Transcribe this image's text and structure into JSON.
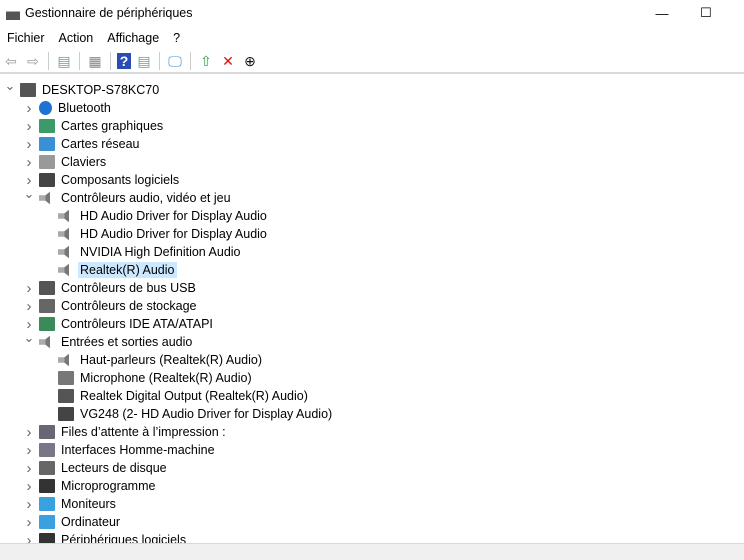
{
  "window": {
    "title": "Gestionnaire de périphériques",
    "minimize": "—",
    "maximize": "☐"
  },
  "menu": [
    "Fichier",
    "Action",
    "Affichage",
    "?"
  ],
  "toolbar": [
    {
      "name": "back-icon",
      "glyph": "⇦",
      "color": "#999"
    },
    {
      "name": "forward-icon",
      "glyph": "⇨",
      "color": "#999"
    },
    {
      "sep": true
    },
    {
      "name": "show-hide-console-tree-icon",
      "glyph": "▤",
      "color": "#6a8"
    },
    {
      "sep": true
    },
    {
      "name": "properties-icon",
      "glyph": "▦",
      "color": "#888"
    },
    {
      "sep": true
    },
    {
      "name": "help-icon",
      "glyph": "?",
      "color": "#fff",
      "bg": "#2a4db3"
    },
    {
      "name": "show-action-pane-icon",
      "glyph": "▤",
      "color": "#6a8"
    },
    {
      "sep": true
    },
    {
      "name": "scan-hardware-icon",
      "glyph": "🖵",
      "color": "#3a8fd6"
    },
    {
      "sep": true
    },
    {
      "name": "update-driver-icon",
      "glyph": "⇧",
      "color": "#2a9d3a"
    },
    {
      "name": "uninstall-icon",
      "glyph": "✕",
      "color": "#e01010"
    },
    {
      "name": "disable-icon",
      "glyph": "⊕",
      "color": "#111"
    }
  ],
  "tree": [
    {
      "level": 0,
      "exp": "open",
      "label": "DESKTOP-S78KC70",
      "icon": "computer-icon",
      "color": "#555"
    },
    {
      "level": 1,
      "exp": "closed",
      "label": "Bluetooth",
      "icon": "bluetooth-icon",
      "color": "#1e73d2"
    },
    {
      "level": 1,
      "exp": "closed",
      "label": "Cartes graphiques",
      "icon": "display-adapter-icon",
      "color": "#3a9a6a"
    },
    {
      "level": 1,
      "exp": "closed",
      "label": "Cartes réseau",
      "icon": "network-icon",
      "color": "#3a8fd6"
    },
    {
      "level": 1,
      "exp": "closed",
      "label": "Claviers",
      "icon": "keyboard-icon",
      "color": "#999"
    },
    {
      "level": 1,
      "exp": "closed",
      "label": "Composants logiciels",
      "icon": "software-component-icon",
      "color": "#444"
    },
    {
      "level": 1,
      "exp": "open",
      "label": "Contrôleurs audio, vidéo et jeu",
      "icon": "speaker-icon",
      "color": "#888"
    },
    {
      "level": 2,
      "label": "HD Audio Driver for Display Audio",
      "icon": "speaker-icon",
      "color": "#888"
    },
    {
      "level": 2,
      "label": "HD Audio Driver for Display Audio",
      "icon": "speaker-icon",
      "color": "#888"
    },
    {
      "level": 2,
      "label": "NVIDIA High Definition Audio",
      "icon": "speaker-icon",
      "color": "#888"
    },
    {
      "level": 2,
      "label": "Realtek(R) Audio",
      "icon": "speaker-icon",
      "color": "#888",
      "selected": true
    },
    {
      "level": 1,
      "exp": "closed",
      "label": "Contrôleurs de bus USB",
      "icon": "usb-icon",
      "color": "#555"
    },
    {
      "level": 1,
      "exp": "closed",
      "label": "Contrôleurs de stockage",
      "icon": "storage-icon",
      "color": "#666"
    },
    {
      "level": 1,
      "exp": "closed",
      "label": "Contrôleurs IDE ATA/ATAPI",
      "icon": "ide-icon",
      "color": "#3a8a5a"
    },
    {
      "level": 1,
      "exp": "open",
      "label": "Entrées et sorties audio",
      "icon": "speaker-icon",
      "color": "#888"
    },
    {
      "level": 2,
      "label": "Haut-parleurs (Realtek(R) Audio)",
      "icon": "speaker-icon",
      "color": "#888"
    },
    {
      "level": 2,
      "label": "Microphone (Realtek(R) Audio)",
      "icon": "microphone-icon",
      "color": "#777"
    },
    {
      "level": 2,
      "label": "Realtek Digital Output (Realtek(R) Audio)",
      "icon": "digital-output-icon",
      "color": "#555"
    },
    {
      "level": 2,
      "label": "VG248 (2- HD Audio Driver for Display Audio)",
      "icon": "monitor-icon",
      "color": "#444"
    },
    {
      "level": 1,
      "exp": "closed",
      "label": "Files d’attente à l’impression :",
      "icon": "printer-icon",
      "color": "#667"
    },
    {
      "level": 1,
      "exp": "closed",
      "label": "Interfaces Homme-machine",
      "icon": "hid-icon",
      "color": "#778"
    },
    {
      "level": 1,
      "exp": "closed",
      "label": "Lecteurs de disque",
      "icon": "disk-drive-icon",
      "color": "#666"
    },
    {
      "level": 1,
      "exp": "closed",
      "label": "Microprogramme",
      "icon": "firmware-icon",
      "color": "#333"
    },
    {
      "level": 1,
      "exp": "closed",
      "label": "Moniteurs",
      "icon": "monitor-icon",
      "color": "#3aa0e0"
    },
    {
      "level": 1,
      "exp": "closed",
      "label": "Ordinateur",
      "icon": "computer-monitor-icon",
      "color": "#3aa0e0"
    },
    {
      "level": 1,
      "exp": "closed",
      "label": "Périphériques logiciels",
      "icon": "software-device-icon",
      "color": "#333"
    }
  ]
}
